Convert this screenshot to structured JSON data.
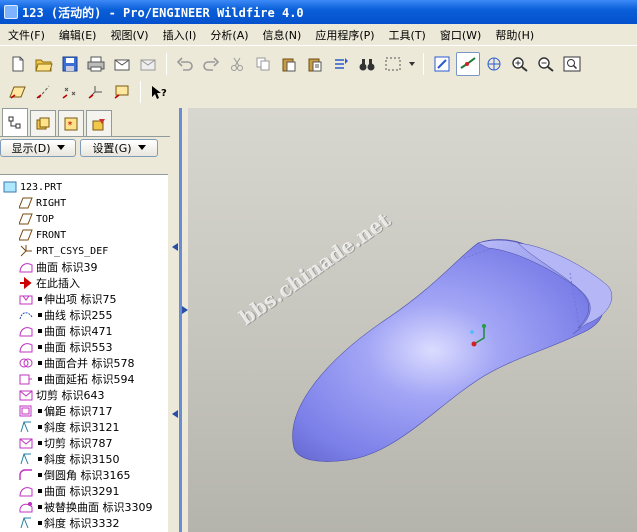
{
  "window": {
    "title": "123 (活动的) - Pro/ENGINEER Wildfire 4.0"
  },
  "menu": [
    "文件(F)",
    "编辑(E)",
    "视图(V)",
    "插入(I)",
    "分析(A)",
    "信息(N)",
    "应用程序(P)",
    "工具(T)",
    "窗口(W)",
    "帮助(H)"
  ],
  "panel": {
    "show_label": "显示(D)",
    "settings_label": "设置(G)"
  },
  "tree": {
    "root": "123.PRT",
    "items": [
      {
        "label": "RIGHT",
        "mono": true,
        "icon": "datum-plane-icon",
        "bullet": false
      },
      {
        "label": "TOP",
        "mono": true,
        "icon": "datum-plane-icon",
        "bullet": false
      },
      {
        "label": "FRONT",
        "mono": true,
        "icon": "datum-plane-icon",
        "bullet": false
      },
      {
        "label": "PRT_CSYS_DEF",
        "mono": true,
        "icon": "csys-icon",
        "bullet": false
      },
      {
        "label": "曲面 标识39",
        "mono": false,
        "icon": "surface-icon",
        "bullet": false
      },
      {
        "label": "在此插入",
        "mono": false,
        "icon": "insert-arrow-icon",
        "bullet": false
      },
      {
        "label": "伸出项 标识75",
        "mono": false,
        "icon": "extrude-icon",
        "bullet": true
      },
      {
        "label": "曲线 标识255",
        "mono": false,
        "icon": "curve-icon",
        "bullet": true
      },
      {
        "label": "曲面 标识471",
        "mono": false,
        "icon": "surface-icon",
        "bullet": true
      },
      {
        "label": "曲面 标识553",
        "mono": false,
        "icon": "surface-icon",
        "bullet": true
      },
      {
        "label": "曲面合并 标识578",
        "mono": false,
        "icon": "merge-icon",
        "bullet": true
      },
      {
        "label": "曲面延拓 标识594",
        "mono": false,
        "icon": "extend-icon",
        "bullet": true
      },
      {
        "label": "切剪 标识643",
        "mono": false,
        "icon": "cut-icon",
        "bullet": false
      },
      {
        "label": "偏距 标识717",
        "mono": false,
        "icon": "offset-icon",
        "bullet": true
      },
      {
        "label": "斜度 标识3121",
        "mono": false,
        "icon": "draft-icon",
        "bullet": true
      },
      {
        "label": "切剪 标识787",
        "mono": false,
        "icon": "cut-icon",
        "bullet": true
      },
      {
        "label": "斜度 标识3150",
        "mono": false,
        "icon": "draft-icon",
        "bullet": true
      },
      {
        "label": "倒圆角 标识3165",
        "mono": false,
        "icon": "round-icon",
        "bullet": true
      },
      {
        "label": "曲面 标识3291",
        "mono": false,
        "icon": "surface-icon",
        "bullet": true
      },
      {
        "label": "被替换曲面 标识3309",
        "mono": false,
        "icon": "replace-icon",
        "bullet": true
      },
      {
        "label": "斜度 标识3332",
        "mono": false,
        "icon": "draft-icon",
        "bullet": true
      }
    ]
  },
  "viewport": {
    "watermark": "bbs.chinade.net"
  },
  "colors": {
    "model": "#8a8ef0",
    "title": "#0a5fd8"
  }
}
